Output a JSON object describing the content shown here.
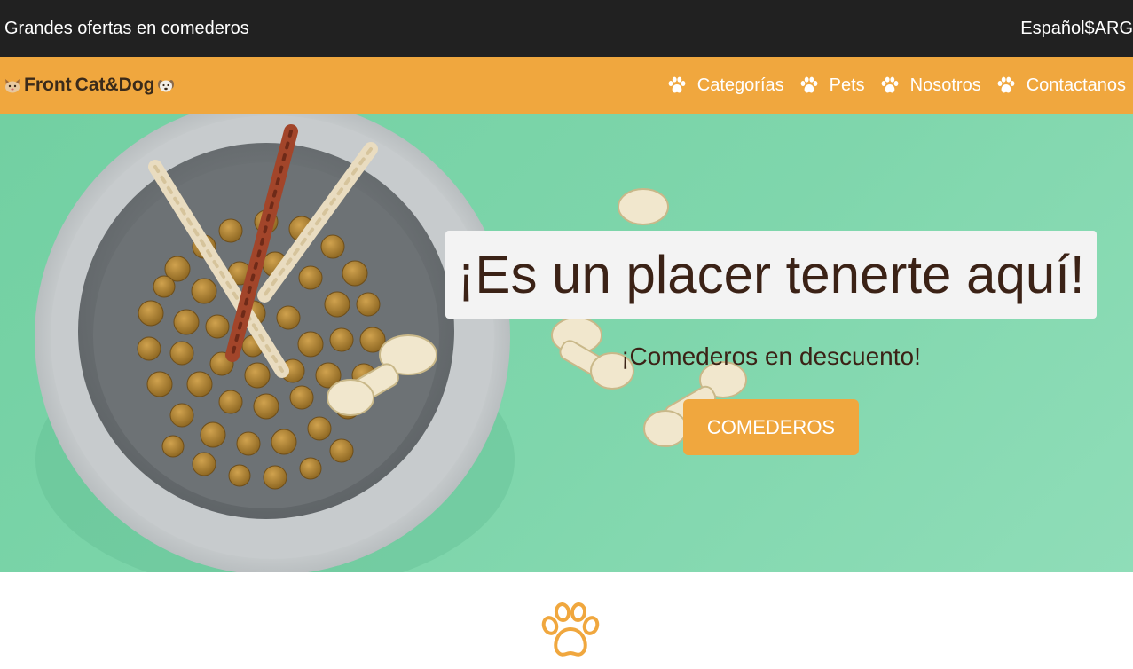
{
  "topbar": {
    "promo": "Grandes ofertas en comederos",
    "language": "Español",
    "currency": "$ARG"
  },
  "nav": {
    "brand_part1": "Front",
    "brand_part2": "Cat&Dog",
    "items": [
      {
        "label": "Categorías",
        "icon": "paw-icon"
      },
      {
        "label": "Pets",
        "icon": "paw-icon"
      },
      {
        "label": "Nosotros",
        "icon": "paw-icon"
      },
      {
        "label": "Contactanos",
        "icon": "paw-icon"
      }
    ]
  },
  "hero": {
    "title": "¡Es un placer tenerte aquí!",
    "subtitle": "¡Comederos en descuento!",
    "button_label": "COMEDEROS"
  },
  "colors": {
    "topbar_bg": "#212121",
    "nav_bg": "#F0A73E",
    "hero_bg": "#7fd6ac",
    "title_text": "#3b2216",
    "accent": "#F0A73E"
  }
}
